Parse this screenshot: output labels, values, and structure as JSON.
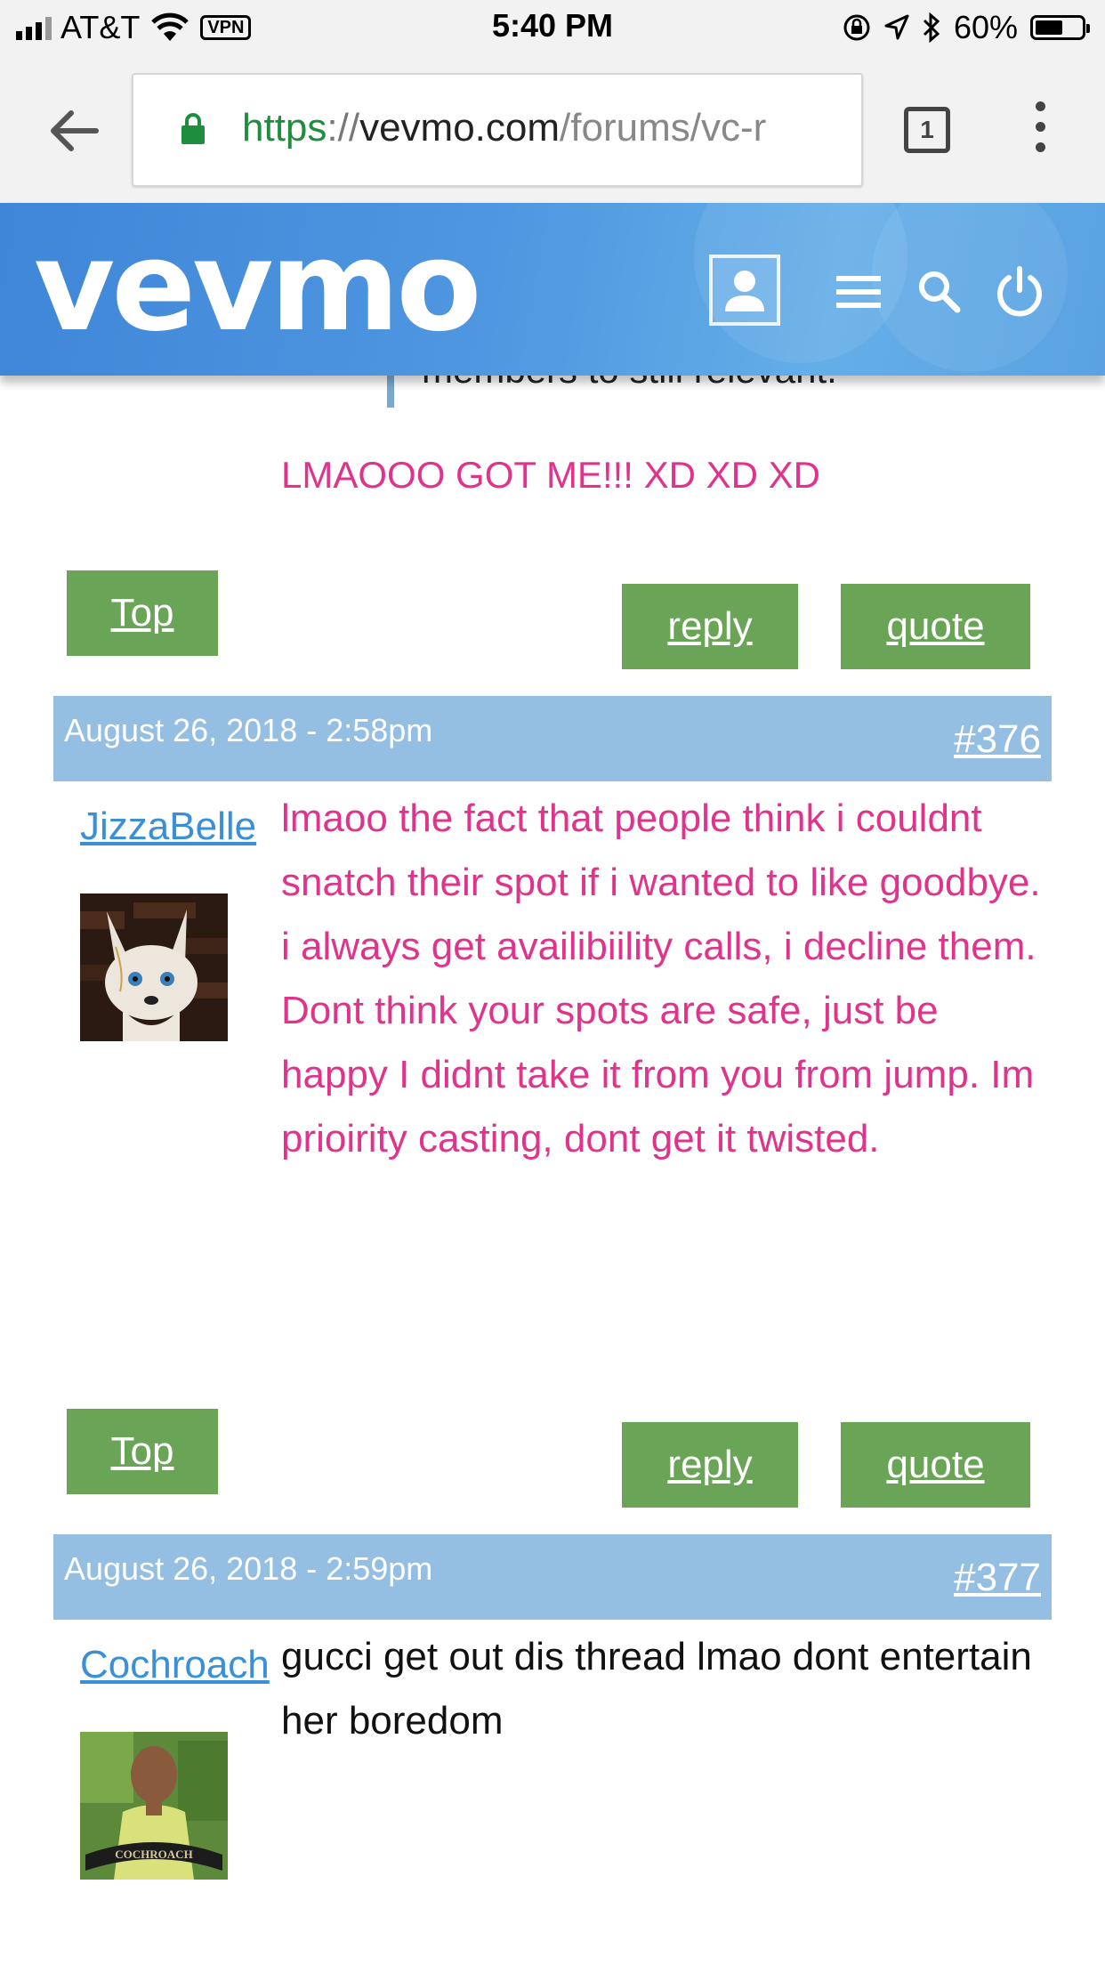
{
  "status_bar": {
    "carrier": "AT&T",
    "vpn": "VPN",
    "time": "5:40 PM",
    "battery": "60%",
    "battery_level": 0.6
  },
  "browser": {
    "url_scheme": "https",
    "url_sep": "://",
    "url_host": "vevmo.com",
    "url_path": "/forums/vc-r",
    "tab_count": "1"
  },
  "site": {
    "logo": "vevmo"
  },
  "thread": {
    "quoted_text": "members to still relevant.",
    "prev_post_text": "LMAOOO GOT ME!!! XD XD XD",
    "buttons": {
      "top": "Top",
      "reply": "reply",
      "quote": "quote"
    },
    "posts": [
      {
        "date": "August 26, 2018 - 2:58pm",
        "number": "#376",
        "author": "JizzaBelle",
        "avatar": "fox-avatar",
        "body": "lmaoo the fact that people think i couldnt snatch their spot if i wanted to like goodbye. i always get availibiility calls, i decline them. Dont think your spots are safe, just be happy I didnt take it from you from jump. Im prioirity casting, dont get it twisted.",
        "color": "#e0348c"
      },
      {
        "date": "August 26, 2018 - 2:59pm",
        "number": "#377",
        "author": "Cochroach",
        "avatar": "cochroach-avatar",
        "avatar_caption": "COCHROACH",
        "body": "gucci get out dis thread lmao dont entertain her boredom",
        "color": "#111111"
      }
    ]
  }
}
